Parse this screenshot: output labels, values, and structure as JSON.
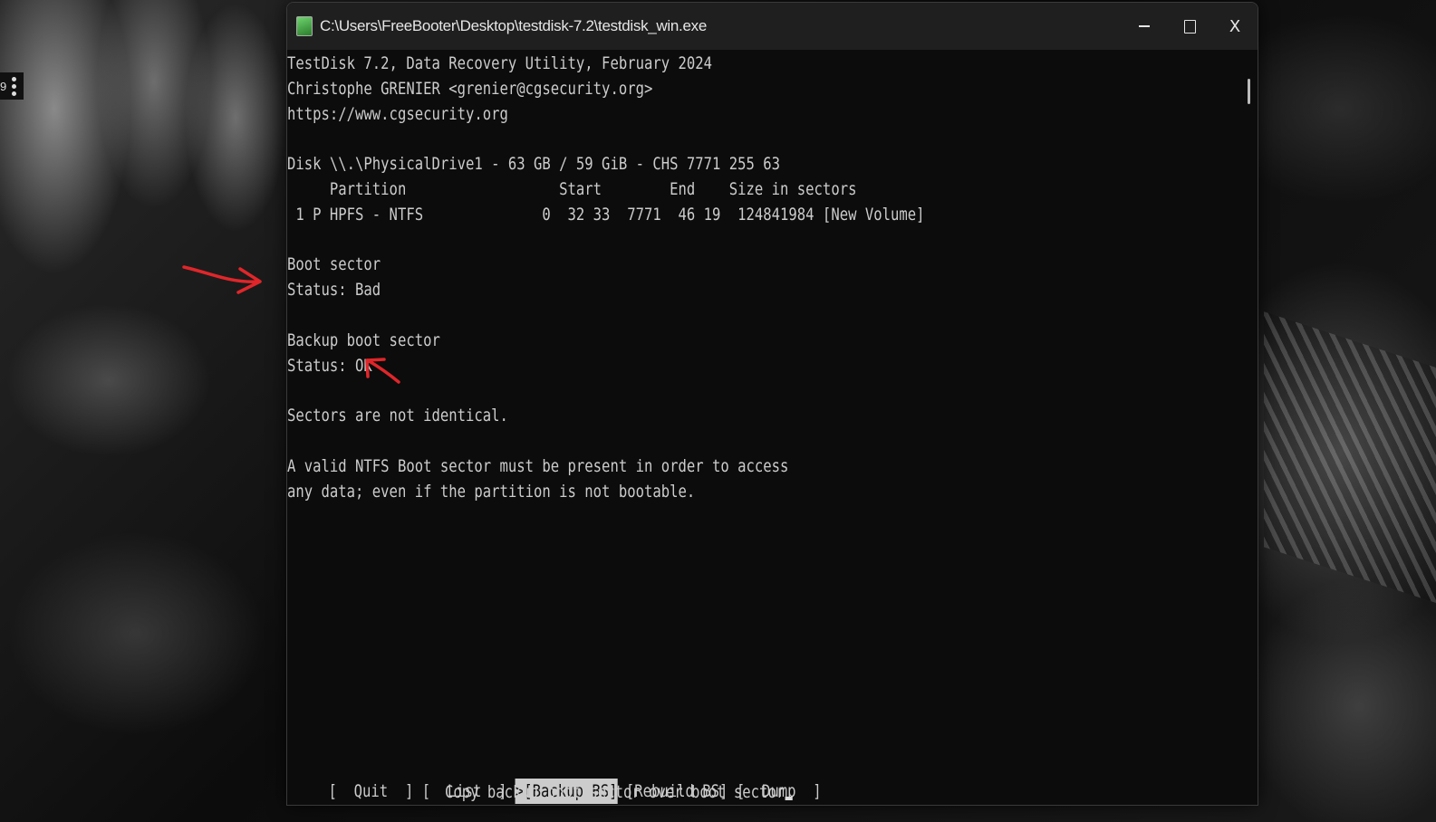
{
  "desktop": {
    "corner_badge_text": "9"
  },
  "window": {
    "title": "C:\\Users\\FreeBooter\\Desktop\\testdisk-7.2\\testdisk_win.exe",
    "controls": {
      "close_glyph": "X"
    }
  },
  "console": {
    "lines": [
      "TestDisk 7.2, Data Recovery Utility, February 2024",
      "Christophe GRENIER <grenier@cgsecurity.org>",
      "https://www.cgsecurity.org",
      "",
      "Disk \\\\.\\PhysicalDrive1 - 63 GB / 59 GiB - CHS 7771 255 63",
      "     Partition                  Start        End    Size in sectors",
      " 1 P HPFS - NTFS              0  32 33  7771  46 19  124841984 [New Volume]",
      "",
      "Boot sector",
      "Status: Bad",
      "",
      "Backup boot sector",
      "Status: OK",
      "",
      "Sectors are not identical.",
      "",
      "A valid NTFS Boot sector must be present in order to access",
      "any data; even if the partition is not bootable."
    ]
  },
  "menu": {
    "items": [
      {
        "label": "[  Quit  ]",
        "selected": false
      },
      {
        "label": "[  List  ]",
        "selected": false
      },
      {
        "label": ">[Backup BS]",
        "selected": true
      },
      {
        "label": "[Rebuild BS]",
        "selected": false
      },
      {
        "label": "[  Dump  ]",
        "selected": false
      }
    ],
    "hint": "Copy backup boot sector over boot sector"
  },
  "annotations": {
    "color": "#e0262a"
  }
}
